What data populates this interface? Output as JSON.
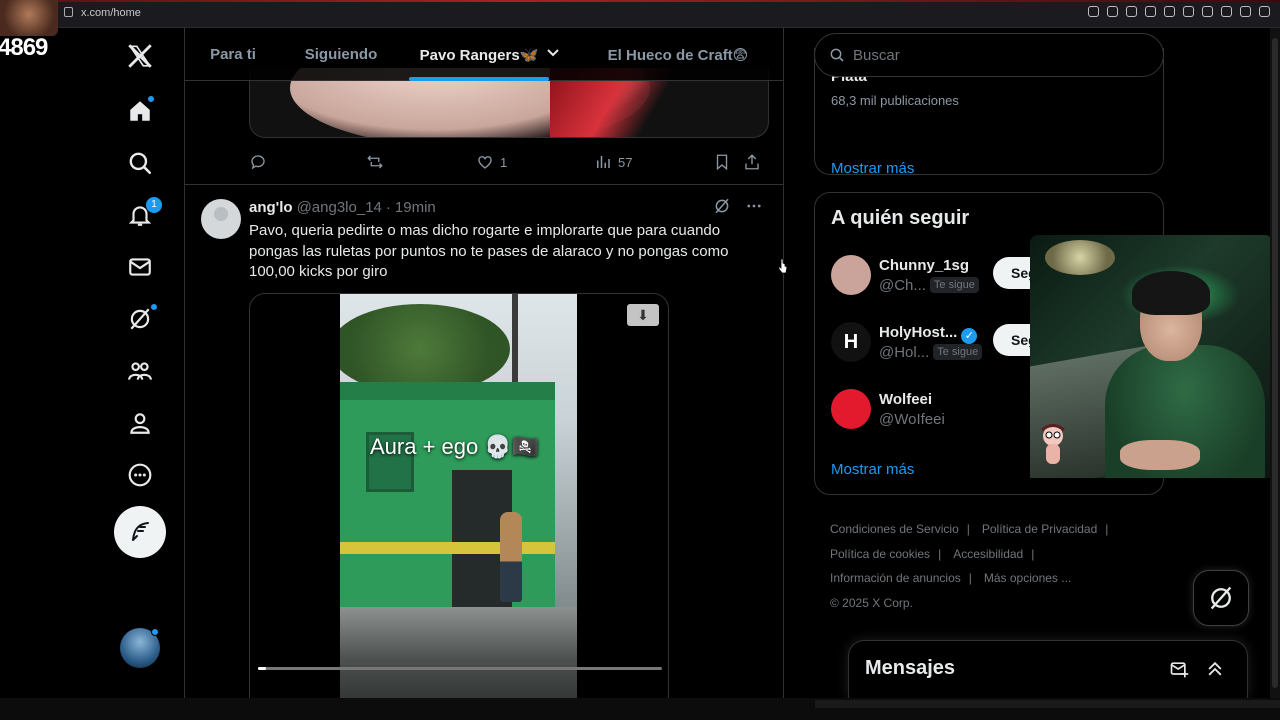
{
  "browser": {
    "url": "x.com/home"
  },
  "stream": {
    "viewer_count": "4869"
  },
  "tabs": [
    {
      "label": "Para ti",
      "active": false
    },
    {
      "label": "Siguiendo",
      "active": false
    },
    {
      "label": "Pavo Rangers🦋",
      "active": true
    },
    {
      "label": "El Hueco de Craft😨",
      "active": false
    }
  ],
  "nav": {
    "notifications_badge": "1"
  },
  "prev_post_actions": {
    "likes": "1",
    "views": "57"
  },
  "post": {
    "name": "ang'lo",
    "handle": "@ang3lo_14",
    "time": "19min",
    "text": "Pavo, queria pedirte o mas dicho rogarte e implorarte que para cuando pongas las ruletas por puntos no te pases de alaraco y no pongas como 100,00 kicks por giro",
    "video_overlay": "Aura + ego 💀🏴‍☠️",
    "video_progress": 0.02
  },
  "right": {
    "search_placeholder": "Buscar",
    "trend_name": "Plata",
    "trend_count": "68,3 mil publicaciones",
    "show_more": "Mostrar más",
    "who_to_follow_title": "A quién seguir",
    "who_to_follow": [
      {
        "name": "Chunny_1sg",
        "handle": "@Ch...",
        "follows_you": "Te sigue",
        "button": "Seguir",
        "verified": false,
        "avatar_color": "#caa49a"
      },
      {
        "name": "HolyHost...",
        "handle": "@Hol...",
        "follows_you": "Te sigue",
        "button": "Seguir",
        "verified": true,
        "avatar_color": "#111111"
      },
      {
        "name": "Wolfeei",
        "handle": "@WoIfeei",
        "follows_you": "",
        "button": "",
        "verified": false,
        "avatar_color": "#e3192e"
      }
    ],
    "footer": {
      "terms": "Condiciones de Servicio",
      "privacy": "Política de Privacidad",
      "cookies": "Política de cookies",
      "accessibility": "Accesibilidad",
      "ads": "Información de anuncios",
      "more": "Más opciones ...",
      "copyright": "© 2025 X Corp."
    },
    "messages_title": "Mensajes"
  },
  "colors": {
    "accent": "#1d9bf0",
    "background": "#000000",
    "border": "#2f3336"
  }
}
